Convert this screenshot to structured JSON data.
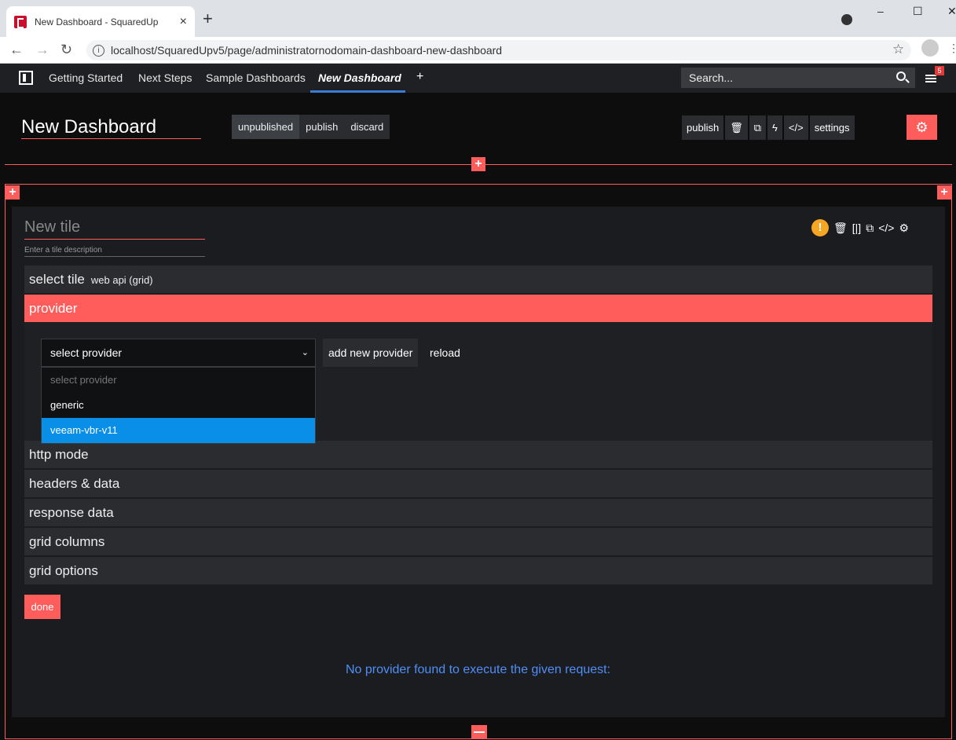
{
  "browser": {
    "tab_title": "New Dashboard - SquaredUp",
    "tab_close": "×",
    "new_tab": "+",
    "url": "localhost/SquaredUpv5/page/administratornodomain-dashboard-new-dashboard",
    "win_min": "–",
    "win_max": "☐",
    "win_close": "✕"
  },
  "appnav": {
    "items": [
      "Getting Started",
      "Next Steps",
      "Sample Dashboards",
      "New Dashboard"
    ],
    "active": "New Dashboard",
    "add": "+",
    "search_placeholder": "Search...",
    "notification_count": "5"
  },
  "dashboard": {
    "title": "New Dashboard",
    "status": "unpublished",
    "publish": "publish",
    "discard": "discard",
    "tools": [
      "publish",
      "settings"
    ]
  },
  "tile": {
    "title": "New tile",
    "description": "Enter a tile description",
    "sections": {
      "select_tile": "select tile",
      "select_tile_value": "web api (grid)",
      "provider": "provider",
      "http_mode": "http mode",
      "headers_data": "headers & data",
      "response_data": "response data",
      "grid_columns": "grid columns",
      "grid_options": "grid options"
    },
    "provider_select": {
      "value": "select provider",
      "options": [
        "select provider",
        "generic",
        "veeam-vbr-v11"
      ],
      "highlighted": "veeam-vbr-v11"
    },
    "add_provider": "add new provider",
    "reload": "reload",
    "done": "done",
    "error": "No provider found to execute the given request:"
  },
  "colors": {
    "accent": "#ff5c5c",
    "selected": "#0a8fe8",
    "error_text": "#4f8ef7",
    "warning": "#f5a623"
  }
}
